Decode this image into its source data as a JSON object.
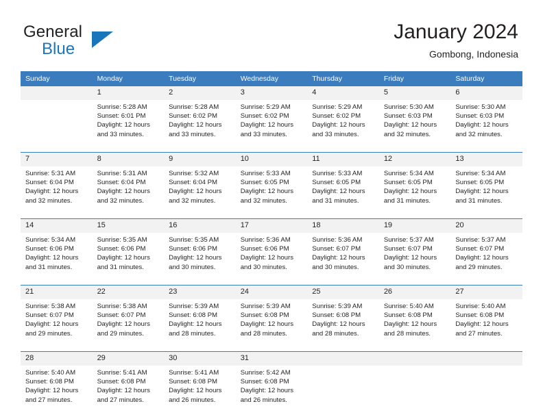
{
  "brand": {
    "word1": "General",
    "word2": "Blue",
    "accent_color": "#1b75bb",
    "triangle_icon": "brand-triangle-icon"
  },
  "header": {
    "title": "January 2024",
    "location": "Gombong, Indonesia"
  },
  "calendar": {
    "header_bg": "#3b7cbe",
    "daynum_bg": "#f2f2f2",
    "weekday_labels": [
      "Sunday",
      "Monday",
      "Tuesday",
      "Wednesday",
      "Thursday",
      "Friday",
      "Saturday"
    ],
    "weeks": [
      [
        {
          "day": "",
          "sunrise": "",
          "sunset": "",
          "daylight_1": "",
          "daylight_2": ""
        },
        {
          "day": "1",
          "sunrise": "Sunrise: 5:28 AM",
          "sunset": "Sunset: 6:01 PM",
          "daylight_1": "Daylight: 12 hours",
          "daylight_2": "and 33 minutes."
        },
        {
          "day": "2",
          "sunrise": "Sunrise: 5:28 AM",
          "sunset": "Sunset: 6:02 PM",
          "daylight_1": "Daylight: 12 hours",
          "daylight_2": "and 33 minutes."
        },
        {
          "day": "3",
          "sunrise": "Sunrise: 5:29 AM",
          "sunset": "Sunset: 6:02 PM",
          "daylight_1": "Daylight: 12 hours",
          "daylight_2": "and 33 minutes."
        },
        {
          "day": "4",
          "sunrise": "Sunrise: 5:29 AM",
          "sunset": "Sunset: 6:02 PM",
          "daylight_1": "Daylight: 12 hours",
          "daylight_2": "and 33 minutes."
        },
        {
          "day": "5",
          "sunrise": "Sunrise: 5:30 AM",
          "sunset": "Sunset: 6:03 PM",
          "daylight_1": "Daylight: 12 hours",
          "daylight_2": "and 32 minutes."
        },
        {
          "day": "6",
          "sunrise": "Sunrise: 5:30 AM",
          "sunset": "Sunset: 6:03 PM",
          "daylight_1": "Daylight: 12 hours",
          "daylight_2": "and 32 minutes."
        }
      ],
      [
        {
          "day": "7",
          "sunrise": "Sunrise: 5:31 AM",
          "sunset": "Sunset: 6:04 PM",
          "daylight_1": "Daylight: 12 hours",
          "daylight_2": "and 32 minutes."
        },
        {
          "day": "8",
          "sunrise": "Sunrise: 5:31 AM",
          "sunset": "Sunset: 6:04 PM",
          "daylight_1": "Daylight: 12 hours",
          "daylight_2": "and 32 minutes."
        },
        {
          "day": "9",
          "sunrise": "Sunrise: 5:32 AM",
          "sunset": "Sunset: 6:04 PM",
          "daylight_1": "Daylight: 12 hours",
          "daylight_2": "and 32 minutes."
        },
        {
          "day": "10",
          "sunrise": "Sunrise: 5:33 AM",
          "sunset": "Sunset: 6:05 PM",
          "daylight_1": "Daylight: 12 hours",
          "daylight_2": "and 32 minutes."
        },
        {
          "day": "11",
          "sunrise": "Sunrise: 5:33 AM",
          "sunset": "Sunset: 6:05 PM",
          "daylight_1": "Daylight: 12 hours",
          "daylight_2": "and 31 minutes."
        },
        {
          "day": "12",
          "sunrise": "Sunrise: 5:34 AM",
          "sunset": "Sunset: 6:05 PM",
          "daylight_1": "Daylight: 12 hours",
          "daylight_2": "and 31 minutes."
        },
        {
          "day": "13",
          "sunrise": "Sunrise: 5:34 AM",
          "sunset": "Sunset: 6:05 PM",
          "daylight_1": "Daylight: 12 hours",
          "daylight_2": "and 31 minutes."
        }
      ],
      [
        {
          "day": "14",
          "sunrise": "Sunrise: 5:34 AM",
          "sunset": "Sunset: 6:06 PM",
          "daylight_1": "Daylight: 12 hours",
          "daylight_2": "and 31 minutes."
        },
        {
          "day": "15",
          "sunrise": "Sunrise: 5:35 AM",
          "sunset": "Sunset: 6:06 PM",
          "daylight_1": "Daylight: 12 hours",
          "daylight_2": "and 31 minutes."
        },
        {
          "day": "16",
          "sunrise": "Sunrise: 5:35 AM",
          "sunset": "Sunset: 6:06 PM",
          "daylight_1": "Daylight: 12 hours",
          "daylight_2": "and 30 minutes."
        },
        {
          "day": "17",
          "sunrise": "Sunrise: 5:36 AM",
          "sunset": "Sunset: 6:06 PM",
          "daylight_1": "Daylight: 12 hours",
          "daylight_2": "and 30 minutes."
        },
        {
          "day": "18",
          "sunrise": "Sunrise: 5:36 AM",
          "sunset": "Sunset: 6:07 PM",
          "daylight_1": "Daylight: 12 hours",
          "daylight_2": "and 30 minutes."
        },
        {
          "day": "19",
          "sunrise": "Sunrise: 5:37 AM",
          "sunset": "Sunset: 6:07 PM",
          "daylight_1": "Daylight: 12 hours",
          "daylight_2": "and 30 minutes."
        },
        {
          "day": "20",
          "sunrise": "Sunrise: 5:37 AM",
          "sunset": "Sunset: 6:07 PM",
          "daylight_1": "Daylight: 12 hours",
          "daylight_2": "and 29 minutes."
        }
      ],
      [
        {
          "day": "21",
          "sunrise": "Sunrise: 5:38 AM",
          "sunset": "Sunset: 6:07 PM",
          "daylight_1": "Daylight: 12 hours",
          "daylight_2": "and 29 minutes."
        },
        {
          "day": "22",
          "sunrise": "Sunrise: 5:38 AM",
          "sunset": "Sunset: 6:07 PM",
          "daylight_1": "Daylight: 12 hours",
          "daylight_2": "and 29 minutes."
        },
        {
          "day": "23",
          "sunrise": "Sunrise: 5:39 AM",
          "sunset": "Sunset: 6:08 PM",
          "daylight_1": "Daylight: 12 hours",
          "daylight_2": "and 28 minutes."
        },
        {
          "day": "24",
          "sunrise": "Sunrise: 5:39 AM",
          "sunset": "Sunset: 6:08 PM",
          "daylight_1": "Daylight: 12 hours",
          "daylight_2": "and 28 minutes."
        },
        {
          "day": "25",
          "sunrise": "Sunrise: 5:39 AM",
          "sunset": "Sunset: 6:08 PM",
          "daylight_1": "Daylight: 12 hours",
          "daylight_2": "and 28 minutes."
        },
        {
          "day": "26",
          "sunrise": "Sunrise: 5:40 AM",
          "sunset": "Sunset: 6:08 PM",
          "daylight_1": "Daylight: 12 hours",
          "daylight_2": "and 28 minutes."
        },
        {
          "day": "27",
          "sunrise": "Sunrise: 5:40 AM",
          "sunset": "Sunset: 6:08 PM",
          "daylight_1": "Daylight: 12 hours",
          "daylight_2": "and 27 minutes."
        }
      ],
      [
        {
          "day": "28",
          "sunrise": "Sunrise: 5:40 AM",
          "sunset": "Sunset: 6:08 PM",
          "daylight_1": "Daylight: 12 hours",
          "daylight_2": "and 27 minutes."
        },
        {
          "day": "29",
          "sunrise": "Sunrise: 5:41 AM",
          "sunset": "Sunset: 6:08 PM",
          "daylight_1": "Daylight: 12 hours",
          "daylight_2": "and 27 minutes."
        },
        {
          "day": "30",
          "sunrise": "Sunrise: 5:41 AM",
          "sunset": "Sunset: 6:08 PM",
          "daylight_1": "Daylight: 12 hours",
          "daylight_2": "and 26 minutes."
        },
        {
          "day": "31",
          "sunrise": "Sunrise: 5:42 AM",
          "sunset": "Sunset: 6:08 PM",
          "daylight_1": "Daylight: 12 hours",
          "daylight_2": "and 26 minutes."
        },
        {
          "day": "",
          "sunrise": "",
          "sunset": "",
          "daylight_1": "",
          "daylight_2": ""
        },
        {
          "day": "",
          "sunrise": "",
          "sunset": "",
          "daylight_1": "",
          "daylight_2": ""
        },
        {
          "day": "",
          "sunrise": "",
          "sunset": "",
          "daylight_1": "",
          "daylight_2": ""
        }
      ]
    ]
  }
}
